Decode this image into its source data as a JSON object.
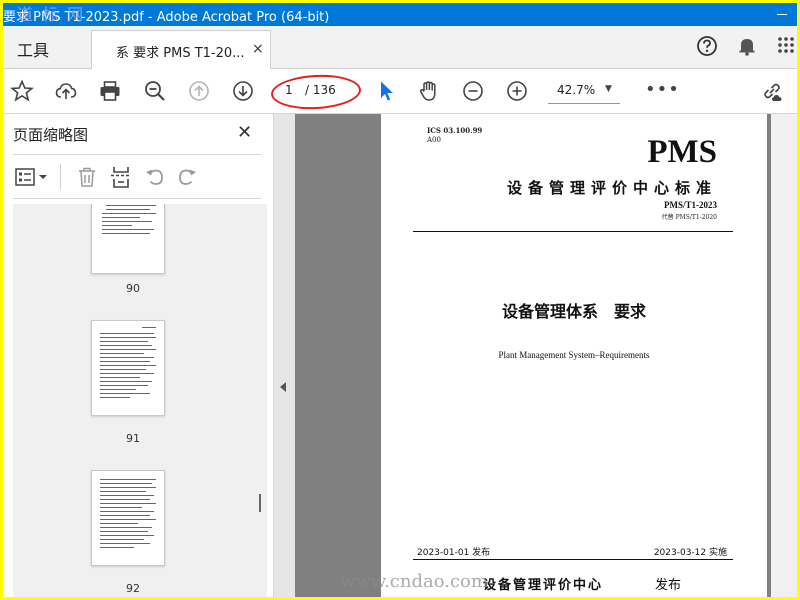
{
  "window": {
    "title": "要求 PMS T1-2023.pdf - Adobe Acrobat Pro (64-bit)",
    "watermark": "道 标 网"
  },
  "tabs": {
    "tools_label": "工具",
    "document_tab_label": "系 要求 PMS T1-20...",
    "close_glyph": "×"
  },
  "toolbar": {
    "current_page": "1",
    "total_pages": "/ 136",
    "zoom_level": "42.7%",
    "zoom_caret": "▼",
    "more_glyph": "•••"
  },
  "thumbnail_panel": {
    "title": "页面缩略图",
    "close_glyph": "✕",
    "thumbnails": [
      {
        "page": "90"
      },
      {
        "page": "91"
      },
      {
        "page": "92"
      }
    ]
  },
  "document": {
    "ics": "ICS 03.100.99",
    "code": "A00",
    "standard_series": "PMS",
    "issuing_body_header": "设备管理评价中心标准",
    "standard_number": "PMS/T1-2023",
    "replaces": "代替 PMS/T1-2020",
    "title_cn": "设备管理体系　要求",
    "title_en": "Plant Management System–Requirements",
    "issue_date": "2023-01-01 发布",
    "implementation_date": "2023-03-12 实施",
    "publisher": "设备管理评价中心",
    "release_word": "发布"
  },
  "overlay": {
    "watermark_url": "www.cndao.com"
  }
}
